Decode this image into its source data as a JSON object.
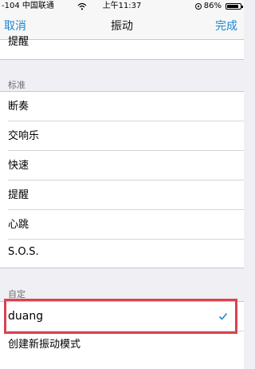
{
  "status_bar": {
    "carrier": "-104 中国联通",
    "time": "上午11:37",
    "battery": "86%",
    "battery_level": 0.86,
    "icons": [
      "wifi-icon",
      "orientation-lock-icon",
      "battery-icon"
    ]
  },
  "nav": {
    "cancel": "取消",
    "title": "振动",
    "done": "完成",
    "accent_color": "#1a86d0"
  },
  "top_item": "提醒",
  "standard": {
    "header": "标准",
    "items": [
      "断奏",
      "交响乐",
      "快速",
      "提醒",
      "心跳",
      "S.O.S."
    ]
  },
  "custom": {
    "header": "自定",
    "selected": "duang",
    "create": "创建新振动模式"
  },
  "highlight_color": "#d9434e"
}
